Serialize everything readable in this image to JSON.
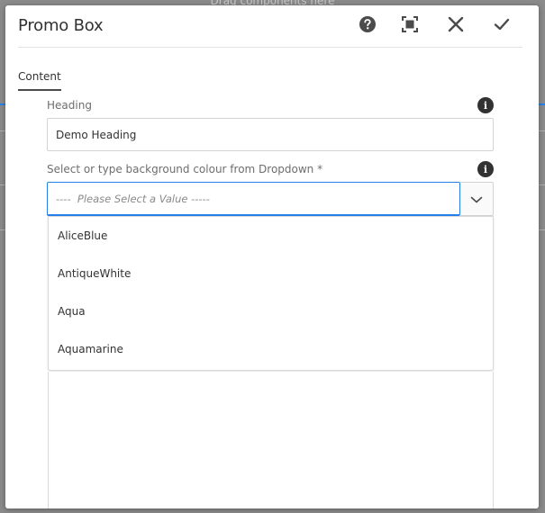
{
  "background": {
    "hint_text": "Drag components here"
  },
  "dialog": {
    "title": "Promo Box",
    "header_icons": [
      "help-icon",
      "fullscreen-icon",
      "close-icon",
      "done-icon"
    ]
  },
  "tabs": [
    {
      "label": "Content",
      "active": true
    }
  ],
  "fields": {
    "heading": {
      "label": "Heading",
      "value": "Demo Heading"
    },
    "background_colour": {
      "label": "Select or type background colour from Dropdown *",
      "placeholder": "----  Please Select a Value -----",
      "value": "",
      "options": [
        "AliceBlue",
        "AntiqueWhite",
        "Aqua",
        "Aquamarine"
      ]
    }
  },
  "colors": {
    "accent": "#2680eb",
    "text": "#323232",
    "label": "#6e6e6e"
  }
}
